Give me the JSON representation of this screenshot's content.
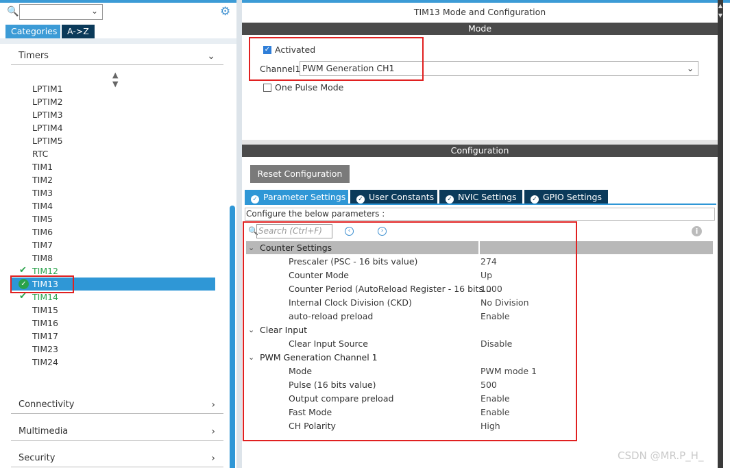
{
  "left": {
    "search_value": "",
    "tabs": [
      "Categories",
      "A->Z"
    ],
    "timers_header": "Timers",
    "items": [
      "LPTIM1",
      "LPTIM2",
      "LPTIM3",
      "LPTIM4",
      "LPTIM5",
      "RTC",
      "TIM1",
      "TIM2",
      "TIM3",
      "TIM4",
      "TIM5",
      "TIM6",
      "TIM7",
      "TIM8",
      "TIM12",
      "TIM13",
      "TIM14",
      "TIM15",
      "TIM16",
      "TIM17",
      "TIM23",
      "TIM24"
    ],
    "sections": [
      "Connectivity",
      "Multimedia",
      "Security"
    ]
  },
  "right": {
    "title": "TIM13 Mode and Configuration",
    "mode_bar": "Mode",
    "activated_label": "Activated",
    "channel1_label": "Channel1",
    "channel1_value": "PWM Generation CH1",
    "one_pulse_label": "One Pulse Mode",
    "config_bar": "Configuration",
    "reset_button": "Reset Configuration",
    "tabs": [
      "Parameter Settings",
      "User Constants",
      "NVIC Settings",
      "GPIO Settings"
    ],
    "configure_note": "Configure the below parameters :",
    "search_placeholder": "Search (Ctrl+F)",
    "groups": [
      {
        "name": "Counter Settings",
        "params": [
          {
            "name": "Prescaler (PSC - 16 bits value)",
            "value": "274"
          },
          {
            "name": "Counter Mode",
            "value": "Up"
          },
          {
            "name": "Counter Period (AutoReload Register - 16 bits...",
            "value": "1000"
          },
          {
            "name": "Internal Clock Division (CKD)",
            "value": "No Division"
          },
          {
            "name": "auto-reload preload",
            "value": "Enable"
          }
        ]
      },
      {
        "name": "Clear Input",
        "params": [
          {
            "name": "Clear Input Source",
            "value": "Disable"
          }
        ]
      },
      {
        "name": "PWM Generation Channel 1",
        "params": [
          {
            "name": "Mode",
            "value": "PWM mode 1"
          },
          {
            "name": "Pulse (16 bits value)",
            "value": "500"
          },
          {
            "name": "Output compare preload",
            "value": "Enable"
          },
          {
            "name": "Fast Mode",
            "value": "Enable"
          },
          {
            "name": "CH Polarity",
            "value": "High"
          }
        ]
      }
    ]
  },
  "watermark": "CSDN @MR.P_H_",
  "colors": {
    "accent": "#2f97d6",
    "dark_tab": "#0b3a5a",
    "ok_green": "#2aa24b",
    "highlight_red": "#e02020"
  }
}
